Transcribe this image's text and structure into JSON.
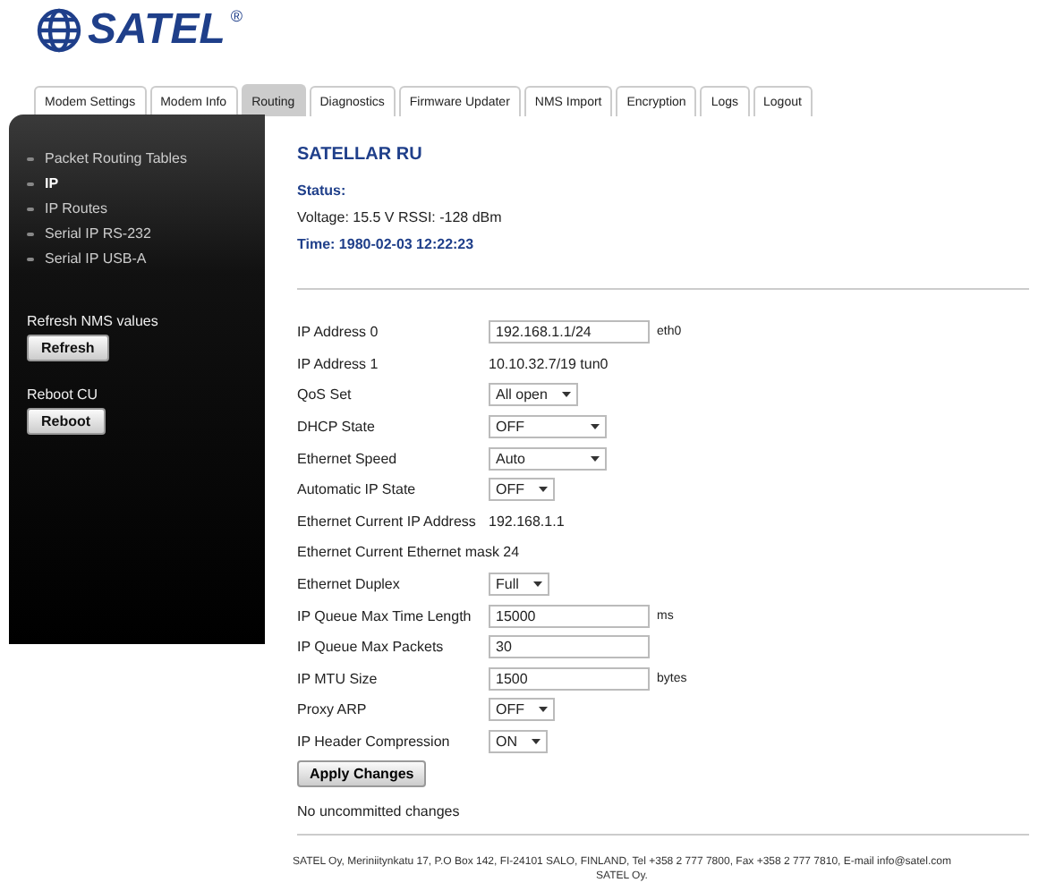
{
  "logo": {
    "text": "SATEL",
    "mark": "®"
  },
  "tabs": [
    {
      "label": "Modem Settings",
      "selected": false
    },
    {
      "label": "Modem Info",
      "selected": false
    },
    {
      "label": "Routing",
      "selected": true
    },
    {
      "label": "Diagnostics",
      "selected": false
    },
    {
      "label": "Firmware Updater",
      "selected": false
    },
    {
      "label": "NMS Import",
      "selected": false
    },
    {
      "label": "Encryption",
      "selected": false
    },
    {
      "label": "Logs",
      "selected": false
    },
    {
      "label": "Logout",
      "selected": false
    }
  ],
  "sidebar": {
    "items": [
      {
        "label": "Packet Routing Tables",
        "selected": false
      },
      {
        "label": "IP",
        "selected": true
      },
      {
        "label": "IP Routes",
        "selected": false
      },
      {
        "label": "Serial IP RS-232",
        "selected": false
      },
      {
        "label": "Serial IP USB-A",
        "selected": false
      }
    ],
    "actions": [
      {
        "label": "Refresh NMS values",
        "button": "Refresh"
      },
      {
        "label": "Reboot CU",
        "button": "Reboot"
      }
    ]
  },
  "device": {
    "title": "SATELLAR RU",
    "status_label": "Status:",
    "status": "Voltage: 15.5 V RSSI: -128 dBm",
    "time": "Time: 1980-02-03 12:22:23"
  },
  "fields": [
    {
      "kind": "input",
      "label": "IP Address 0",
      "value": "192.168.1.1/24",
      "unit": "eth0"
    },
    {
      "kind": "text",
      "label": "IP Address 1",
      "value": "10.10.32.7/19 tun0"
    },
    {
      "kind": "select",
      "label": "QoS Set",
      "value": "All open"
    },
    {
      "kind": "select",
      "label": "DHCP State",
      "value": "OFF",
      "wide": true
    },
    {
      "kind": "select",
      "label": "Ethernet Speed",
      "value": "Auto",
      "wide": true
    },
    {
      "kind": "select",
      "label": "Automatic IP State",
      "value": "OFF"
    },
    {
      "kind": "text",
      "label": "Ethernet Current IP Address",
      "value": "192.168.1.1"
    },
    {
      "kind": "inline",
      "label": "Ethernet Current Ethernet mask 24"
    },
    {
      "kind": "select",
      "label": "Ethernet Duplex",
      "value": "Full"
    },
    {
      "kind": "input",
      "label": "IP Queue Max Time Length",
      "value": "15000",
      "unit": "ms"
    },
    {
      "kind": "input",
      "label": "IP Queue Max Packets",
      "value": "30"
    },
    {
      "kind": "input",
      "label": "IP MTU Size",
      "value": "1500",
      "unit": "bytes"
    },
    {
      "kind": "select",
      "label": "Proxy ARP",
      "value": "OFF"
    },
    {
      "kind": "select",
      "label": "IP Header Compression",
      "value": "ON"
    }
  ],
  "apply_button": "Apply Changes",
  "commit_status": "No uncommitted changes",
  "footer": [
    "SATEL Oy, Meriniitynkatu 17, P.O Box 142, FI-24101 SALO, FINLAND, Tel +358 2 777 7800, Fax +358 2 777 7810, E-mail info@satel.com",
    "SATEL Oy."
  ]
}
